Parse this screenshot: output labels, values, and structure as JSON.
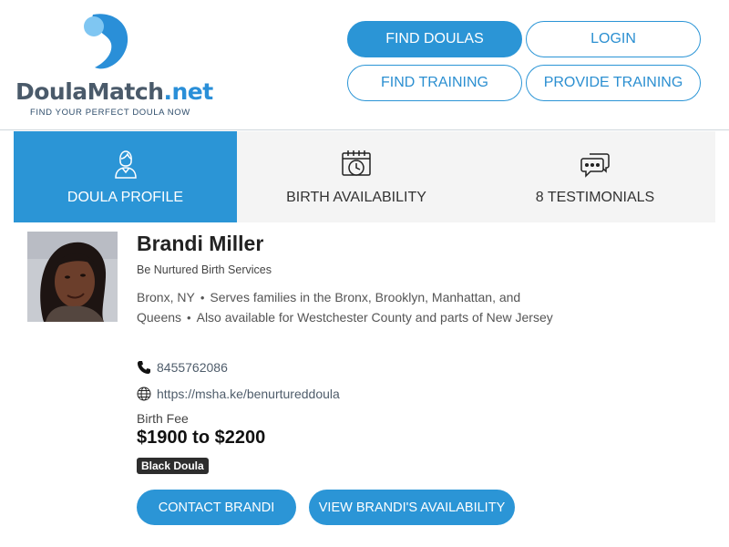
{
  "brand": {
    "name_main": "DoulaMatch",
    "name_tld": ".net",
    "tagline": "FIND YOUR PERFECT DOULA NOW",
    "accent_color": "#2b95d6"
  },
  "nav": {
    "find_doulas": "FIND DOULAS",
    "login": "LOGIN",
    "find_training": "FIND TRAINING",
    "provide_training": "PROVIDE TRAINING"
  },
  "tabs": [
    {
      "label": "DOULA PROFILE",
      "icon": "doula-person-icon",
      "active": true
    },
    {
      "label": "BIRTH AVAILABILITY",
      "icon": "calendar-clock-icon",
      "active": false
    },
    {
      "label": "8 TESTIMONIALS",
      "icon": "chat-bubbles-icon",
      "active": false
    }
  ],
  "profile": {
    "name": "Brandi Miller",
    "business": "Be Nurtured Birth Services",
    "location": "Bronx, NY",
    "service_1": "Serves families in the Bronx, Brooklyn, Manhattan, and Queens",
    "service_2": "Also available for Westchester County and parts of New Jersey",
    "phone": "8455762086",
    "website": "https://msha.ke/benurtureddoula",
    "fee_label": "Birth Fee",
    "fee_value": "$1900 to $2200",
    "badge": "Black Doula",
    "contact_button": "CONTACT BRANDI",
    "availability_button": "VIEW BRANDI'S AVAILABILITY"
  }
}
